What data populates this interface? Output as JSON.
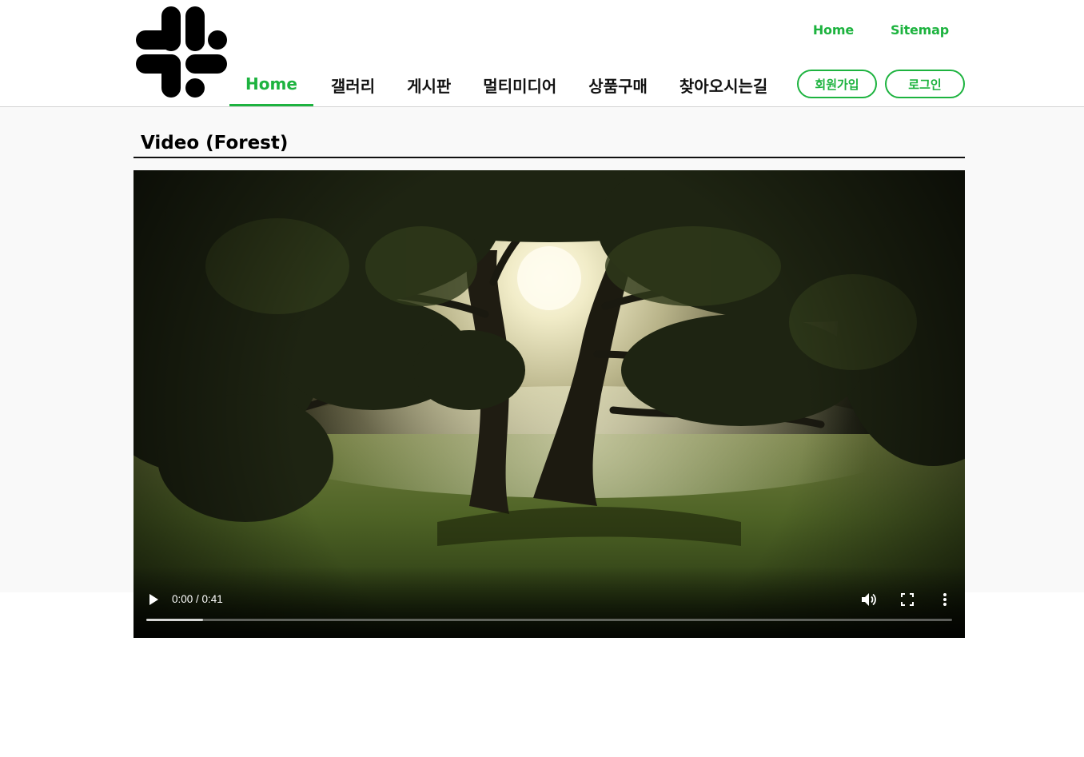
{
  "colors": {
    "accent": "#1db33f"
  },
  "header": {
    "logo_icon": "slack-like-hash-logo",
    "util_links": [
      "Home",
      "Sitemap"
    ],
    "nav": [
      {
        "label": "Home",
        "active": true
      },
      {
        "label": "갤러리",
        "active": false
      },
      {
        "label": "게시판",
        "active": false
      },
      {
        "label": "멀티미디어",
        "active": false
      },
      {
        "label": "상품구매",
        "active": false
      },
      {
        "label": "찾아오시는길",
        "active": false
      }
    ],
    "join_label": "회원가입",
    "login_label": "로그인"
  },
  "main": {
    "title": "Video (Forest)",
    "video": {
      "current_time": "0:00",
      "duration": "0:41",
      "time_display": "0:00 / 0:41",
      "buffered_fraction": 0.07,
      "icons": [
        "play-icon",
        "volume-icon",
        "fullscreen-icon",
        "more-options-icon"
      ]
    }
  }
}
